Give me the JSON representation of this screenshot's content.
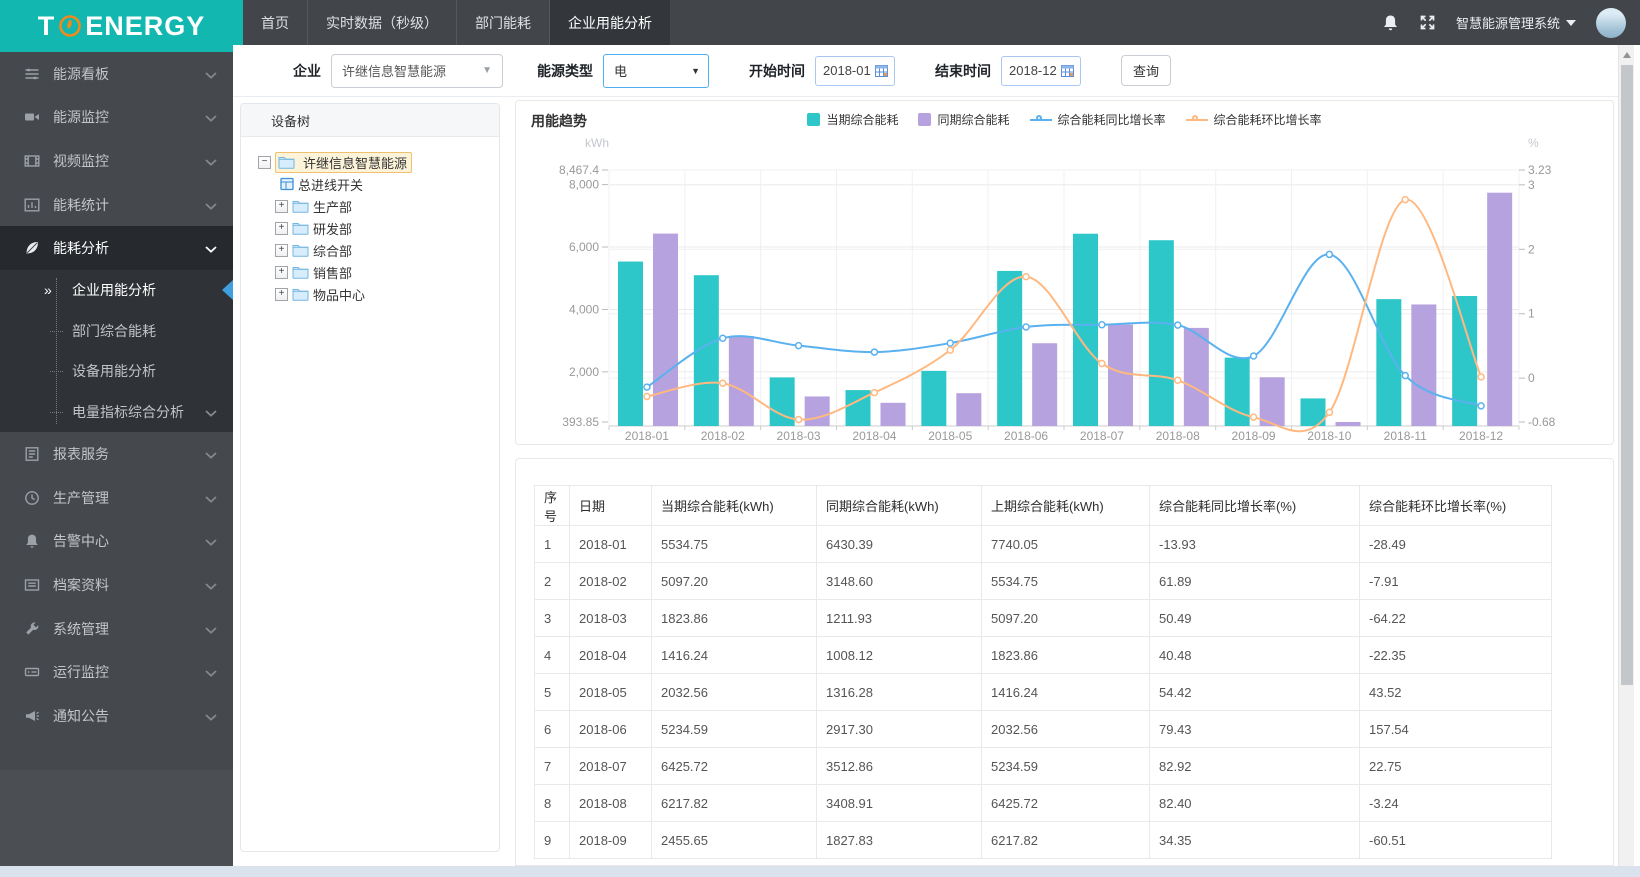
{
  "logo": {
    "part1": "T",
    "part2": "ENERGY"
  },
  "topnav": {
    "items": [
      {
        "label": "首页",
        "active": false
      },
      {
        "label": "实时数据（秒级）",
        "active": false
      },
      {
        "label": "部门能耗",
        "active": false
      },
      {
        "label": "企业用能分析",
        "active": true
      }
    ]
  },
  "topbar_right": {
    "system_label": "智慧能源管理系统"
  },
  "sidebar": {
    "items": [
      {
        "icon": "dashboard-icon",
        "label": "能源看板",
        "chevron": true
      },
      {
        "icon": "camera-icon",
        "label": "能源监控",
        "chevron": true
      },
      {
        "icon": "film-icon",
        "label": "视频监控",
        "chevron": true
      },
      {
        "icon": "stats-icon",
        "label": "能耗统计",
        "chevron": true
      },
      {
        "icon": "leaf-icon",
        "label": "能耗分析",
        "chevron": true,
        "open": true,
        "children": [
          {
            "label": "企业用能分析",
            "active": true
          },
          {
            "label": "部门综合能耗"
          },
          {
            "label": "设备用能分析"
          },
          {
            "label": "电量指标综合分析",
            "chevron": true
          }
        ]
      },
      {
        "icon": "report-icon",
        "label": "报表服务",
        "chevron": true
      },
      {
        "icon": "clock-icon",
        "label": "生产管理",
        "chevron": true
      },
      {
        "icon": "bell-icon",
        "label": "告警中心",
        "chevron": true
      },
      {
        "icon": "archive-icon",
        "label": "档案资料",
        "chevron": true
      },
      {
        "icon": "wrench-icon",
        "label": "系统管理",
        "chevron": true
      },
      {
        "icon": "drive-icon",
        "label": "运行监控",
        "chevron": true
      },
      {
        "icon": "megaphone-icon",
        "label": "通知公告",
        "chevron": true
      }
    ]
  },
  "filters": {
    "enterprise_label": "企业",
    "enterprise_value": "许继信息智慧能源",
    "energy_type_label": "能源类型",
    "energy_type_value": "电",
    "start_label": "开始时间",
    "start_value": "2018-01",
    "end_label": "结束时间",
    "end_value": "2018-12",
    "query_label": "查询"
  },
  "tree": {
    "title": "设备树",
    "root": {
      "label": "许继信息智慧能源",
      "selected": true,
      "expanded": true
    },
    "nodes": [
      {
        "label": "总进线开关",
        "type": "device"
      },
      {
        "label": "生产部",
        "type": "folder"
      },
      {
        "label": "研发部",
        "type": "folder"
      },
      {
        "label": "综合部",
        "type": "folder"
      },
      {
        "label": "销售部",
        "type": "folder"
      },
      {
        "label": "物品中心",
        "type": "folder"
      }
    ]
  },
  "chart_data": {
    "type": "bar+line",
    "title": "用能趋势",
    "categories": [
      "2018-01",
      "2018-02",
      "2018-03",
      "2018-04",
      "2018-05",
      "2018-06",
      "2018-07",
      "2018-08",
      "2018-09",
      "2018-10",
      "2018-11",
      "2018-12"
    ],
    "series": [
      {
        "name": "当期综合能耗",
        "type": "bar",
        "axis": "left",
        "color": "#2ec7c9",
        "values": [
          5534.75,
          5097.2,
          1823.86,
          1416.24,
          2032.56,
          5234.59,
          6425.72,
          6217.82,
          2455.65,
          1150,
          4330,
          4430
        ]
      },
      {
        "name": "同期综合能耗",
        "type": "bar",
        "axis": "left",
        "color": "#b6a2de",
        "values": [
          6430.39,
          3148.6,
          1211.93,
          1008.12,
          1316.28,
          2917.3,
          3512.86,
          3408.91,
          1827.83,
          393.85,
          4160,
          7740.05
        ]
      },
      {
        "name": "综合能耗同比增长率",
        "type": "line",
        "axis": "right",
        "color": "#5ab1ef",
        "values": [
          -0.1393,
          0.6189,
          0.5049,
          0.4048,
          0.5442,
          0.7943,
          0.8292,
          0.824,
          0.3435,
          1.92,
          0.04,
          -0.43
        ]
      },
      {
        "name": "综合能耗环比增长率",
        "type": "line",
        "axis": "right",
        "color": "#ffb980",
        "values": [
          -0.2849,
          -0.0791,
          -0.6422,
          -0.2235,
          0.4352,
          1.5754,
          0.2275,
          -0.0324,
          -0.6051,
          -0.53,
          2.77,
          0.02
        ]
      }
    ],
    "left_axis": {
      "unit": "kWh",
      "min": 393.85,
      "max": 8467.4,
      "tick_values": [
        393.85,
        2000,
        4000,
        6000,
        8000,
        8467.4
      ],
      "tick_labels": [
        "393.85",
        "2,000",
        "4,000",
        "6,000",
        "8,000",
        "8,467.4"
      ]
    },
    "right_axis": {
      "unit": "%",
      "min": -0.68,
      "max": 3.23,
      "tick_values": [
        -0.68,
        0,
        1,
        2,
        3,
        3.23
      ],
      "tick_labels": [
        "-0.68",
        "0",
        "1",
        "2",
        "3",
        "3.23"
      ]
    },
    "legend_position": "top-center",
    "grid": true
  },
  "table": {
    "columns": [
      "序号",
      "日期",
      "当期综合能耗(kWh)",
      "同期综合能耗(kWh)",
      "上期综合能耗(kWh)",
      "综合能耗同比增长率(%)",
      "综合能耗环比增长率(%)"
    ],
    "rows": [
      [
        "1",
        "2018-01",
        "5534.75",
        "6430.39",
        "7740.05",
        "-13.93",
        "-28.49"
      ],
      [
        "2",
        "2018-02",
        "5097.20",
        "3148.60",
        "5534.75",
        "61.89",
        "-7.91"
      ],
      [
        "3",
        "2018-03",
        "1823.86",
        "1211.93",
        "5097.20",
        "50.49",
        "-64.22"
      ],
      [
        "4",
        "2018-04",
        "1416.24",
        "1008.12",
        "1823.86",
        "40.48",
        "-22.35"
      ],
      [
        "5",
        "2018-05",
        "2032.56",
        "1316.28",
        "1416.24",
        "54.42",
        "43.52"
      ],
      [
        "6",
        "2018-06",
        "5234.59",
        "2917.30",
        "2032.56",
        "79.43",
        "157.54"
      ],
      [
        "7",
        "2018-07",
        "6425.72",
        "3512.86",
        "5234.59",
        "82.92",
        "22.75"
      ],
      [
        "8",
        "2018-08",
        "6217.82",
        "3408.91",
        "6425.72",
        "82.40",
        "-3.24"
      ],
      [
        "9",
        "2018-09",
        "2455.65",
        "1827.83",
        "6217.82",
        "34.35",
        "-60.51"
      ]
    ]
  }
}
